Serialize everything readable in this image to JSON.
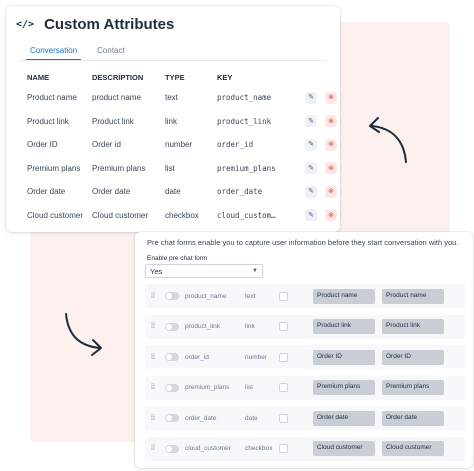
{
  "attributes_card": {
    "title": "Custom Attributes",
    "tabs": [
      "Conversation",
      "Contact"
    ],
    "columns": [
      "NAME",
      "DESCRIPTION",
      "TYPE",
      "KEY"
    ],
    "rows": [
      {
        "name": "Product name",
        "description": "product name",
        "type": "text",
        "key": "product_name"
      },
      {
        "name": "Product link",
        "description": "Product link",
        "type": "link",
        "key": "product_link"
      },
      {
        "name": "Order ID",
        "description": "Order id",
        "type": "number",
        "key": "order_id"
      },
      {
        "name": "Premium plans",
        "description": "Premium plans",
        "type": "list",
        "key": "premium_plans"
      },
      {
        "name": "Order date",
        "description": "Order date",
        "type": "date",
        "key": "order_date"
      },
      {
        "name": "Cloud customer",
        "description": "Cloud customer",
        "type": "checkbox",
        "key": "cloud_custom…"
      }
    ]
  },
  "prechat_card": {
    "description": "Pre chat forms enable you to capture user information before they start conversation with you.",
    "enable_label": "Enable pre chat form",
    "enable_value": "Yes",
    "fields": [
      {
        "key": "product_name",
        "type": "text",
        "label": "Product name",
        "placeholder": "Product name"
      },
      {
        "key": "product_link",
        "type": "link",
        "label": "Product link",
        "placeholder": "Product link"
      },
      {
        "key": "order_id",
        "type": "number",
        "label": "Order ID",
        "placeholder": "Order ID"
      },
      {
        "key": "premium_plans",
        "type": "list",
        "label": "Premium plans",
        "placeholder": "Premium plans"
      },
      {
        "key": "order_date",
        "type": "date",
        "label": "Order date",
        "placeholder": "Order date"
      },
      {
        "key": "cloud_customer",
        "type": "checkbox",
        "label": "Cloud customer",
        "placeholder": "Cloud customer"
      }
    ]
  },
  "colors": {
    "accent": "#1f6fd1",
    "delete": "#e14b4b",
    "background_tint": "#fdf1ef"
  }
}
